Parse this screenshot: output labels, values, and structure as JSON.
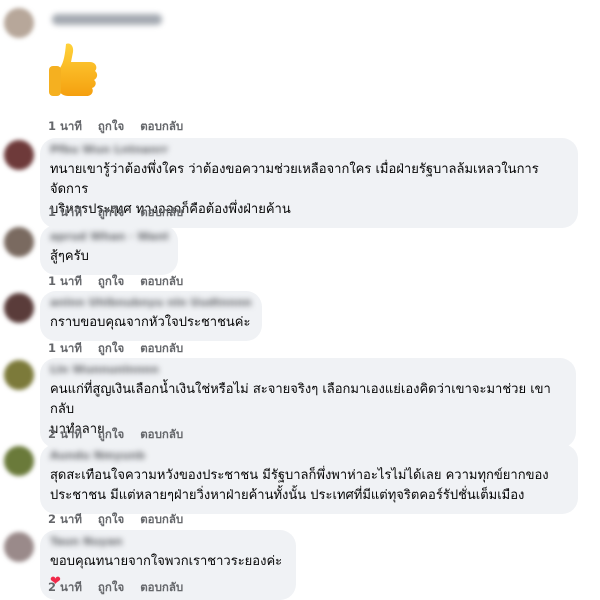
{
  "comments": [
    {
      "name": "Tn ttd Wenaanllnn",
      "avatar_color": "#b7a79a",
      "sticker": "thumbs-up",
      "text": "",
      "time": "1 นาที"
    },
    {
      "name": "Pfbu Wun Lntnanrr",
      "avatar_color": "#6e3a3a",
      "text": "ทนายเขารู้ว่าต้องพึ่งใคร ว่าต้องขอความช่วยเหลือจากใคร เมื่อฝ่ายรัฐบาลล้มเหลวในการจัดการ\nบริหารประเทศ ทางออกก็คือต้องพึ่งฝ่ายค้าน",
      "time": "1 นาที"
    },
    {
      "name": "aprud Whan · Wantu",
      "avatar_color": "#7a6a60",
      "text": "สู้ๆครับ",
      "time": "1 นาที"
    },
    {
      "name": "anlnn Uhlbnubnyu nln Uudtnnnnnd",
      "avatar_color": "#5a3c3a",
      "text": "กราบขอบคุณจากหัวใจประชาชนค่ะ",
      "time": "1 นาที"
    },
    {
      "name": "Lln Wunnunlnnnn",
      "avatar_color": "#7c7a3a",
      "text": "คนแก่ที่สูญเงินเลือกน้ำเงินใช่หรือไม่ สะจายจริงๆ เลือกมาเองแย่เองคิดว่าเขาจะมาช่วย เขากลับ\nมาทำลาย",
      "time": "2 นาที"
    },
    {
      "name": "Aundu Nmyunb",
      "avatar_color": "#6a7a3a",
      "text": "สุดสะเทือนใจความหวังของประชาชน มีรัฐบาลก็พึ่งพาห่าอะไรไม่ได้เลย ความทุกข์ยากของ\nประชาชน มีแต่หลายๆฝ่ายวิ่งหาฝ่ายค้านทั้งนั้น ประเทศที่มีแต่ทุจริตคอร์รัปชั่นเต็มเมือง",
      "time": "2 นาที"
    },
    {
      "name": "Taun Nuyan",
      "avatar_color": "#9a8a8a",
      "text": "ขอบคุณทนายจากใจพวกเราชาวระยองค่ะ",
      "heart": "❤",
      "time": "2 นาที"
    }
  ],
  "labels": {
    "like": "ถูกใจ",
    "reply": "ตอบกลับ"
  }
}
